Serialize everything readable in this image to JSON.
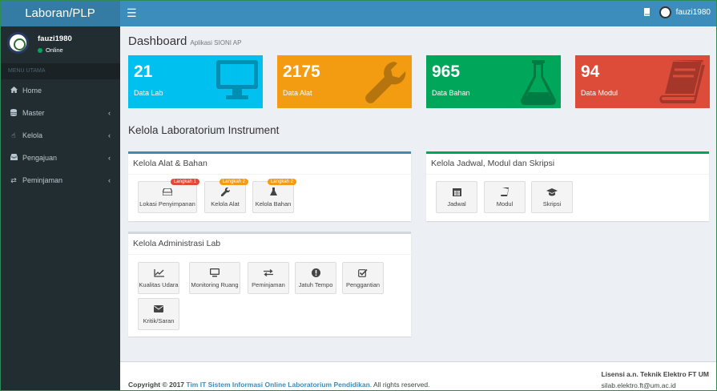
{
  "header": {
    "logo": "Laboran/PLP",
    "user": "fauzi1980"
  },
  "sidebar": {
    "user_name": "fauzi1980",
    "status": "Online",
    "menu_header": "MENU UTAMA",
    "items": [
      {
        "label": "Home",
        "icon": "home-icon"
      },
      {
        "label": "Master",
        "icon": "database-icon"
      },
      {
        "label": "Kelola",
        "icon": "hand-icon"
      },
      {
        "label": "Pengajuan",
        "icon": "inbox-icon"
      },
      {
        "label": "Peminjaman",
        "icon": "exchange-icon"
      }
    ]
  },
  "page": {
    "title": "Dashboard",
    "subtitle": "Aplikasi SIONI AP"
  },
  "stats": [
    {
      "value": "21",
      "label": "Data Lab",
      "color": "#00c0ef",
      "icon": "monitor-icon"
    },
    {
      "value": "2175",
      "label": "Data Alat",
      "color": "#f39c12",
      "icon": "wrench-icon"
    },
    {
      "value": "965",
      "label": "Data Bahan",
      "color": "#00a65a",
      "icon": "flask-icon"
    },
    {
      "value": "94",
      "label": "Data Modul",
      "color": "#dd4b39",
      "icon": "book-icon"
    }
  ],
  "section_title": "Kelola Laboratorium Instrument",
  "box_alat": {
    "title": "Kelola Alat & Bahan",
    "tiles": [
      {
        "label": "Lokasi Penyimpanan",
        "badge": "Langkah 1",
        "badge_color": "#dd4b39",
        "icon": "hdd-icon"
      },
      {
        "label": "Kelola Alat",
        "badge": "Langkah 2",
        "badge_color": "#f39c12",
        "icon": "wrench-icon"
      },
      {
        "label": "Kelola Bahan",
        "badge": "Langkah 2",
        "badge_color": "#f39c12",
        "icon": "flask-icon"
      }
    ]
  },
  "box_jadwal": {
    "title": "Kelola Jadwal, Modul dan Skripsi",
    "tiles": [
      {
        "label": "Jadwal",
        "icon": "calendar-icon"
      },
      {
        "label": "Modul",
        "icon": "book-icon"
      },
      {
        "label": "Skripsi",
        "icon": "graduation-cap-icon"
      }
    ]
  },
  "box_admin": {
    "title": "Kelola Administrasi Lab",
    "tiles": [
      {
        "label": "Kualitas Udara",
        "icon": "line-chart-icon"
      },
      {
        "label": "Monitoring Ruang",
        "icon": "monitor-icon"
      },
      {
        "label": "Peminjaman",
        "icon": "exchange-icon"
      },
      {
        "label": "Jatuh Tempo",
        "icon": "exclamation-icon"
      },
      {
        "label": "Penggantian",
        "icon": "check-square-icon"
      },
      {
        "label": "Kritik/Saran",
        "icon": "envelope-icon"
      }
    ]
  },
  "footer": {
    "copyright": "Copyright © 2017",
    "link": "Tim IT Sistem Informasi Online Laboratorium Pendidikan",
    "rights": ". All rights reserved.",
    "license": "Lisensi a.n. Teknik Elektro FT UM",
    "email": "silab.elektro.ft@um.ac.id"
  }
}
